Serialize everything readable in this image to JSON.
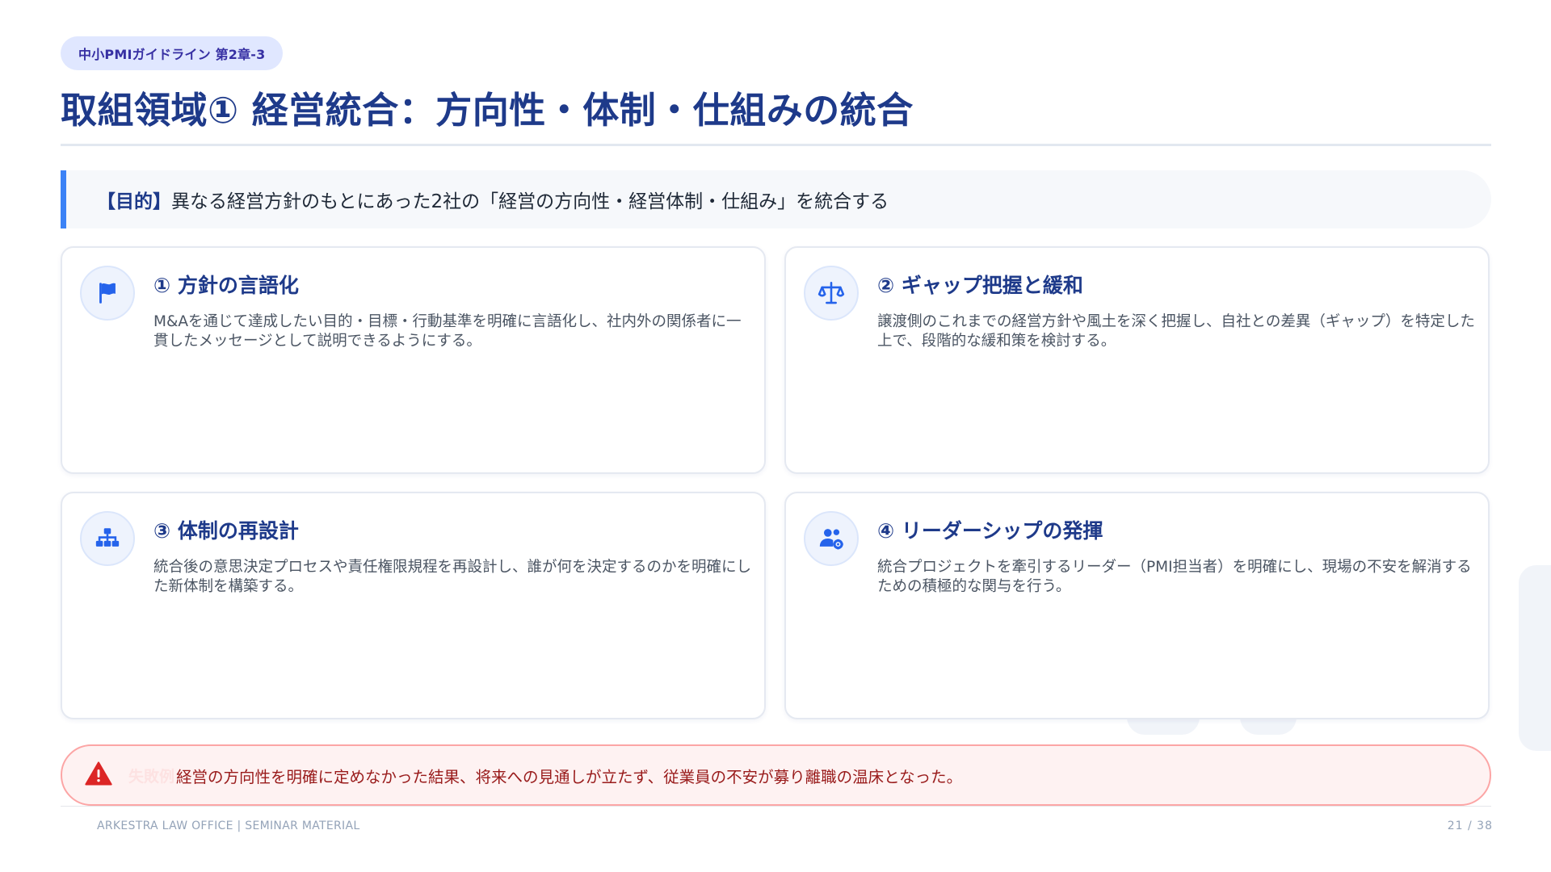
{
  "header": {
    "chip": "中小PMIガイドライン 第2章-3",
    "title": "取組領域① 経営統合：方向性・体制・仕組みの統合"
  },
  "purpose": {
    "label": "【目的】",
    "text": "異なる経営方針のもとにあった2社の「経営の方向性・経営体制・仕組み」を統合する"
  },
  "cards": [
    {
      "icon": "flag-icon",
      "title": "① 方針の言語化",
      "body": "M&Aを通じて達成したい目的・目標・行動基準を明確に言語化し、社内外の関係者に一貫したメッセージとして説明できるようにする。"
    },
    {
      "icon": "scale-balance-icon",
      "title": "② ギャップ把握と緩和",
      "body": "譲渡側のこれまでの経営方針や風土を深く把握し、自社との差異（ギャップ）を特定した上で、段階的な緩和策を検討する。"
    },
    {
      "icon": "org-chart-icon",
      "title": "③ 体制の再設計",
      "body": "統合後の意思決定プロセスや責任権限規程を再設計し、誰が何を決定するのかを明確にした新体制を構築する。"
    },
    {
      "icon": "users-gear-icon",
      "title": "④ リーダーシップの発揮",
      "body": "統合プロジェクトを牽引するリーダー（PMI担当者）を明確にし、現場の不安を解消するための積極的な関与を行う。"
    }
  ],
  "warning": {
    "icon": "warning-triangle-icon",
    "label": "失敗例",
    "text": "経営の方向性を明確に定めなかった結果、将来への見通しが立たず、従業員の不安が募り離職の温床となった。"
  },
  "footer": {
    "left": "ARKESTRA LAW OFFICE | SEMINAR MATERIAL",
    "page": "21 / 38"
  },
  "colors": {
    "primary": "#1e3a8a",
    "accent": "#3b82f6",
    "icon": "#2563eb",
    "warning": "#dc2626"
  }
}
